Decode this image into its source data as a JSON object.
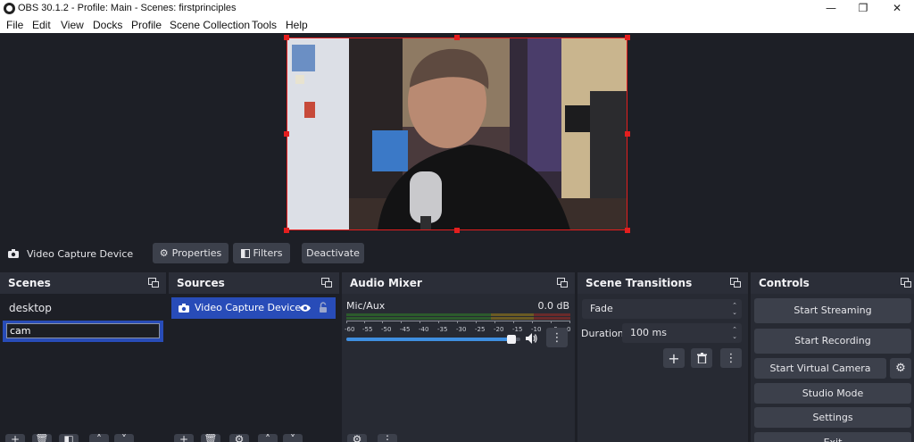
{
  "window": {
    "title": "OBS 30.1.2 - Profile: Main - Scenes: firstprinciples",
    "minimize_glyph": "—",
    "maximize_glyph": "❐",
    "close_glyph": "✕"
  },
  "menu": [
    "File",
    "Edit",
    "View",
    "Docks",
    "Profile",
    "Scene Collection",
    "Tools",
    "Help"
  ],
  "source_toolbar": {
    "source_name": "Video Capture Device",
    "properties_label": "Properties",
    "filters_label": "Filters",
    "deactivate_label": "Deactivate"
  },
  "scenes": {
    "title": "Scenes",
    "items": [
      {
        "label": "desktop",
        "selected": false
      },
      {
        "label": "cam",
        "selected": true,
        "editing": true
      }
    ]
  },
  "sources": {
    "title": "Sources",
    "items": [
      {
        "label": "Video Capture Device",
        "visible": true,
        "locked": false
      }
    ]
  },
  "audio_mixer": {
    "title": "Audio Mixer",
    "channel": {
      "name": "Mic/Aux",
      "level": "0.0 dB",
      "volume_fraction": 0.95
    },
    "scale": [
      "-60",
      "-55",
      "-50",
      "-45",
      "-40",
      "-35",
      "-30",
      "-25",
      "-20",
      "-15",
      "-10",
      "-5",
      "0"
    ]
  },
  "scene_transitions": {
    "title": "Scene Transitions",
    "transition": "Fade",
    "duration_label": "Duration",
    "duration_value": "100 ms"
  },
  "controls": {
    "title": "Controls",
    "buttons": {
      "start_streaming": "Start Streaming",
      "start_recording": "Start Recording",
      "start_virtual_camera": "Start Virtual Camera",
      "studio_mode": "Studio Mode",
      "settings": "Settings",
      "exit": "Exit"
    }
  },
  "colors": {
    "accent": "#284cb8",
    "selection_border": "#e41e1e",
    "panel_bg": "#1d1f26",
    "dock_header": "#2b2e38",
    "button_bg": "#3c404b"
  }
}
